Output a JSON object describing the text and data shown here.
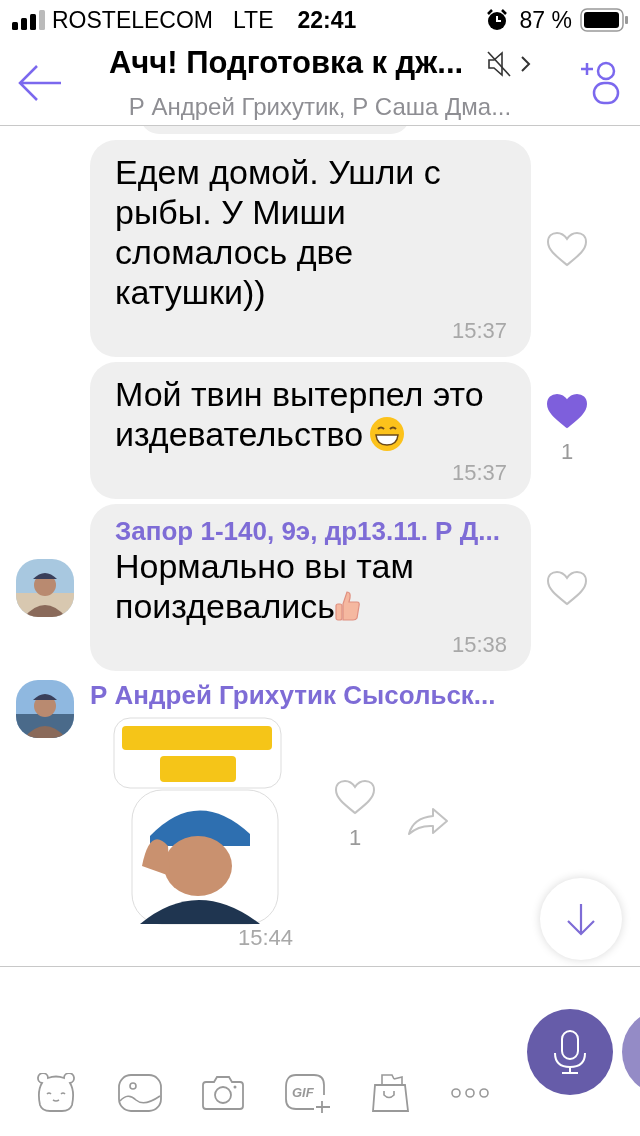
{
  "status_bar": {
    "carrier": "ROSTELECOM",
    "network": "LTE",
    "time": "22:41",
    "battery": "87 %"
  },
  "header": {
    "title": "Ачч! Подготовка к дж...",
    "subtitle": "Р Андрей Грихутик, Р Саша Дма...",
    "muted": true
  },
  "messages": [
    {
      "kind": "text",
      "avatar": false,
      "text": "Едем домой. Ушли с рыбы. У Миши сломалось две катушки))",
      "time": "15:37",
      "liked": false
    },
    {
      "kind": "text",
      "avatar": false,
      "text": "Мой твин вытерпел это издевательство",
      "emoji": {
        "kind": "grin"
      },
      "time": "15:37",
      "liked": true,
      "likes": "1"
    },
    {
      "kind": "text",
      "sender": "Запор 1-140, 9э, др13.11. Р Д...",
      "avatar": true,
      "text": "Нормально вы там поиздевались",
      "emoji": {
        "kind": "thumb"
      },
      "time": "15:38",
      "liked": false
    },
    {
      "kind": "sticker",
      "sender": "Р Андрей Грихутик Сысольск...",
      "avatar": true,
      "time": "15:44",
      "liked": false,
      "likes": "1"
    }
  ],
  "toolbar": {
    "gif_label": "GIF"
  }
}
